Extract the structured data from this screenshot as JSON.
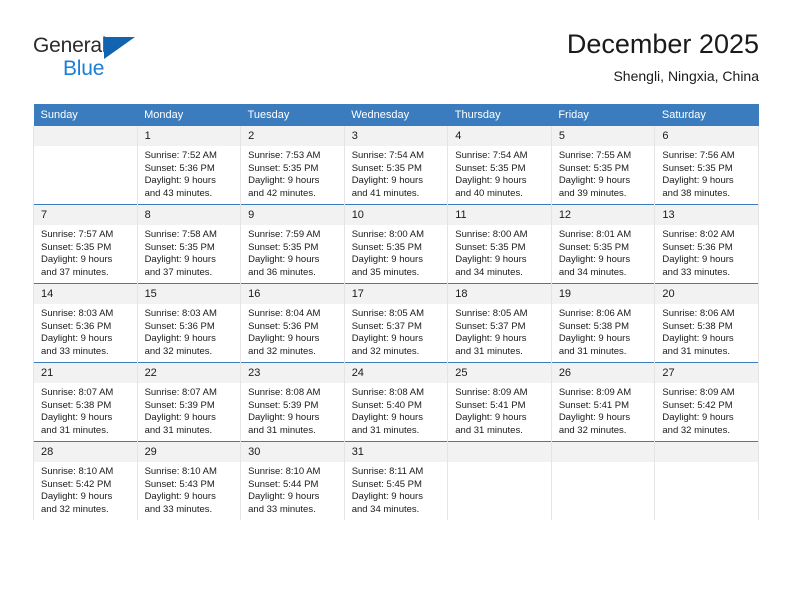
{
  "logo": {
    "line1": "General",
    "line2": "Blue",
    "triangle_color": "#1263b0",
    "blue_text_color": "#1b7fd4"
  },
  "header": {
    "title": "December 2025",
    "location": "Shengli, Ningxia, China"
  },
  "theme": {
    "header_blue": "#3a7cbe",
    "daynum_background": "#f2f2f2",
    "cell_border": "#e4e4e4"
  },
  "weekdays": [
    "Sunday",
    "Monday",
    "Tuesday",
    "Wednesday",
    "Thursday",
    "Friday",
    "Saturday"
  ],
  "weeks": [
    [
      {
        "day": "",
        "lines": []
      },
      {
        "day": "1",
        "lines": [
          "Sunrise: 7:52 AM",
          "Sunset: 5:36 PM",
          "Daylight: 9 hours",
          "and 43 minutes."
        ]
      },
      {
        "day": "2",
        "lines": [
          "Sunrise: 7:53 AM",
          "Sunset: 5:35 PM",
          "Daylight: 9 hours",
          "and 42 minutes."
        ]
      },
      {
        "day": "3",
        "lines": [
          "Sunrise: 7:54 AM",
          "Sunset: 5:35 PM",
          "Daylight: 9 hours",
          "and 41 minutes."
        ]
      },
      {
        "day": "4",
        "lines": [
          "Sunrise: 7:54 AM",
          "Sunset: 5:35 PM",
          "Daylight: 9 hours",
          "and 40 minutes."
        ]
      },
      {
        "day": "5",
        "lines": [
          "Sunrise: 7:55 AM",
          "Sunset: 5:35 PM",
          "Daylight: 9 hours",
          "and 39 minutes."
        ]
      },
      {
        "day": "6",
        "lines": [
          "Sunrise: 7:56 AM",
          "Sunset: 5:35 PM",
          "Daylight: 9 hours",
          "and 38 minutes."
        ]
      }
    ],
    [
      {
        "day": "7",
        "lines": [
          "Sunrise: 7:57 AM",
          "Sunset: 5:35 PM",
          "Daylight: 9 hours",
          "and 37 minutes."
        ]
      },
      {
        "day": "8",
        "lines": [
          "Sunrise: 7:58 AM",
          "Sunset: 5:35 PM",
          "Daylight: 9 hours",
          "and 37 minutes."
        ]
      },
      {
        "day": "9",
        "lines": [
          "Sunrise: 7:59 AM",
          "Sunset: 5:35 PM",
          "Daylight: 9 hours",
          "and 36 minutes."
        ]
      },
      {
        "day": "10",
        "lines": [
          "Sunrise: 8:00 AM",
          "Sunset: 5:35 PM",
          "Daylight: 9 hours",
          "and 35 minutes."
        ]
      },
      {
        "day": "11",
        "lines": [
          "Sunrise: 8:00 AM",
          "Sunset: 5:35 PM",
          "Daylight: 9 hours",
          "and 34 minutes."
        ]
      },
      {
        "day": "12",
        "lines": [
          "Sunrise: 8:01 AM",
          "Sunset: 5:35 PM",
          "Daylight: 9 hours",
          "and 34 minutes."
        ]
      },
      {
        "day": "13",
        "lines": [
          "Sunrise: 8:02 AM",
          "Sunset: 5:36 PM",
          "Daylight: 9 hours",
          "and 33 minutes."
        ]
      }
    ],
    [
      {
        "day": "14",
        "lines": [
          "Sunrise: 8:03 AM",
          "Sunset: 5:36 PM",
          "Daylight: 9 hours",
          "and 33 minutes."
        ]
      },
      {
        "day": "15",
        "lines": [
          "Sunrise: 8:03 AM",
          "Sunset: 5:36 PM",
          "Daylight: 9 hours",
          "and 32 minutes."
        ]
      },
      {
        "day": "16",
        "lines": [
          "Sunrise: 8:04 AM",
          "Sunset: 5:36 PM",
          "Daylight: 9 hours",
          "and 32 minutes."
        ]
      },
      {
        "day": "17",
        "lines": [
          "Sunrise: 8:05 AM",
          "Sunset: 5:37 PM",
          "Daylight: 9 hours",
          "and 32 minutes."
        ]
      },
      {
        "day": "18",
        "lines": [
          "Sunrise: 8:05 AM",
          "Sunset: 5:37 PM",
          "Daylight: 9 hours",
          "and 31 minutes."
        ]
      },
      {
        "day": "19",
        "lines": [
          "Sunrise: 8:06 AM",
          "Sunset: 5:38 PM",
          "Daylight: 9 hours",
          "and 31 minutes."
        ]
      },
      {
        "day": "20",
        "lines": [
          "Sunrise: 8:06 AM",
          "Sunset: 5:38 PM",
          "Daylight: 9 hours",
          "and 31 minutes."
        ]
      }
    ],
    [
      {
        "day": "21",
        "lines": [
          "Sunrise: 8:07 AM",
          "Sunset: 5:38 PM",
          "Daylight: 9 hours",
          "and 31 minutes."
        ]
      },
      {
        "day": "22",
        "lines": [
          "Sunrise: 8:07 AM",
          "Sunset: 5:39 PM",
          "Daylight: 9 hours",
          "and 31 minutes."
        ]
      },
      {
        "day": "23",
        "lines": [
          "Sunrise: 8:08 AM",
          "Sunset: 5:39 PM",
          "Daylight: 9 hours",
          "and 31 minutes."
        ]
      },
      {
        "day": "24",
        "lines": [
          "Sunrise: 8:08 AM",
          "Sunset: 5:40 PM",
          "Daylight: 9 hours",
          "and 31 minutes."
        ]
      },
      {
        "day": "25",
        "lines": [
          "Sunrise: 8:09 AM",
          "Sunset: 5:41 PM",
          "Daylight: 9 hours",
          "and 31 minutes."
        ]
      },
      {
        "day": "26",
        "lines": [
          "Sunrise: 8:09 AM",
          "Sunset: 5:41 PM",
          "Daylight: 9 hours",
          "and 32 minutes."
        ]
      },
      {
        "day": "27",
        "lines": [
          "Sunrise: 8:09 AM",
          "Sunset: 5:42 PM",
          "Daylight: 9 hours",
          "and 32 minutes."
        ]
      }
    ],
    [
      {
        "day": "28",
        "lines": [
          "Sunrise: 8:10 AM",
          "Sunset: 5:42 PM",
          "Daylight: 9 hours",
          "and 32 minutes."
        ]
      },
      {
        "day": "29",
        "lines": [
          "Sunrise: 8:10 AM",
          "Sunset: 5:43 PM",
          "Daylight: 9 hours",
          "and 33 minutes."
        ]
      },
      {
        "day": "30",
        "lines": [
          "Sunrise: 8:10 AM",
          "Sunset: 5:44 PM",
          "Daylight: 9 hours",
          "and 33 minutes."
        ]
      },
      {
        "day": "31",
        "lines": [
          "Sunrise: 8:11 AM",
          "Sunset: 5:45 PM",
          "Daylight: 9 hours",
          "and 34 minutes."
        ]
      },
      {
        "day": "",
        "lines": []
      },
      {
        "day": "",
        "lines": []
      },
      {
        "day": "",
        "lines": []
      }
    ]
  ]
}
